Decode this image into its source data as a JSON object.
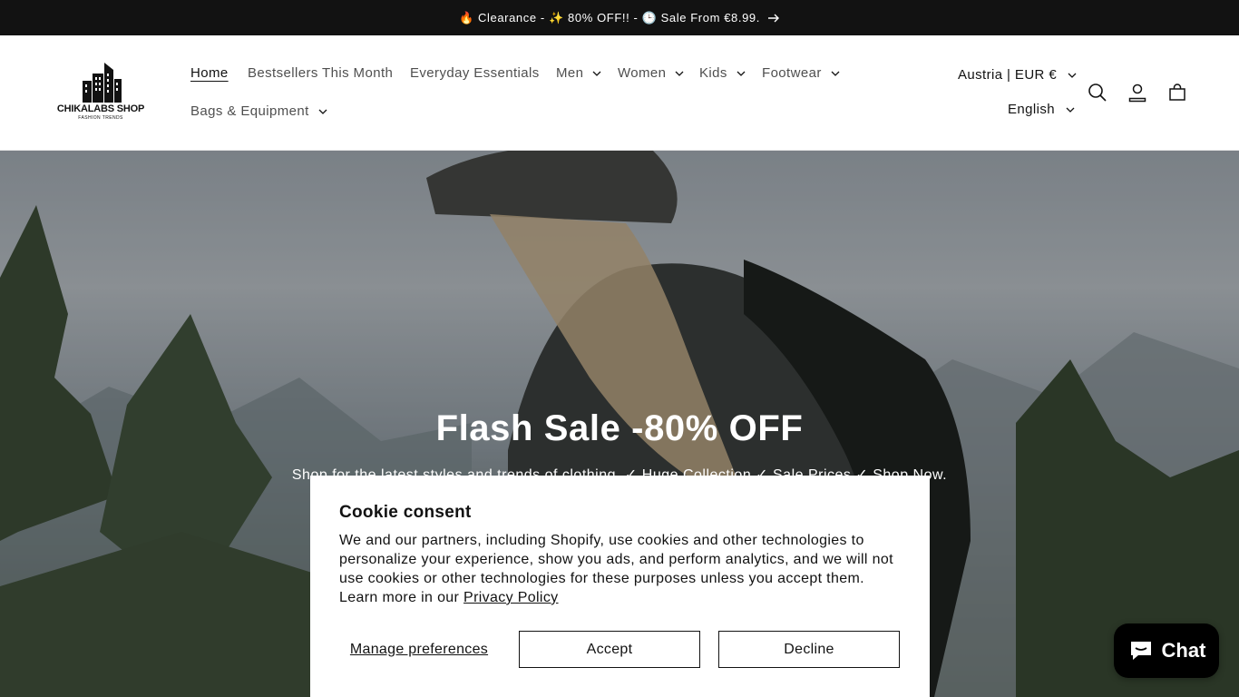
{
  "announcement": {
    "text": "🔥 Clearance - ✨ 80% OFF!! - 🕒 Sale From €8.99."
  },
  "logo": {
    "brand": "CHIKALABS SHOP",
    "tagline": "FASHION TRENDS"
  },
  "nav": {
    "home": "Home",
    "bestsellers": "Bestsellers This Month",
    "essentials": "Everyday Essentials",
    "men": "Men",
    "women": "Women",
    "kids": "Kids",
    "footwear": "Footwear",
    "bags": "Bags & Equipment"
  },
  "localization": {
    "country": "Austria | EUR €",
    "language": "English"
  },
  "hero": {
    "title": "Flash Sale -80% OFF",
    "subtitle": "Shop for the latest styles and trends of clothing. ✓ Huge Collection ✓ Sale Prices ✓ Shop Now."
  },
  "cookie": {
    "title": "Cookie consent",
    "body": "We and our partners, including Shopify, use cookies and other technologies to personalize your experience, show you ads, and perform analytics, and we will not use cookies or other technologies for these purposes unless you accept them. Learn more in our ",
    "link": "Privacy Policy",
    "manage": "Manage preferences",
    "accept": "Accept",
    "decline": "Decline"
  },
  "chat": {
    "label": "Chat"
  },
  "icons": [
    "arrow-right-icon",
    "search-icon",
    "account-icon",
    "cart-icon",
    "chevron-down-icon",
    "chat-icon"
  ],
  "colors": {
    "announcement_bg": "#121212",
    "chat_bg": "#000000"
  }
}
